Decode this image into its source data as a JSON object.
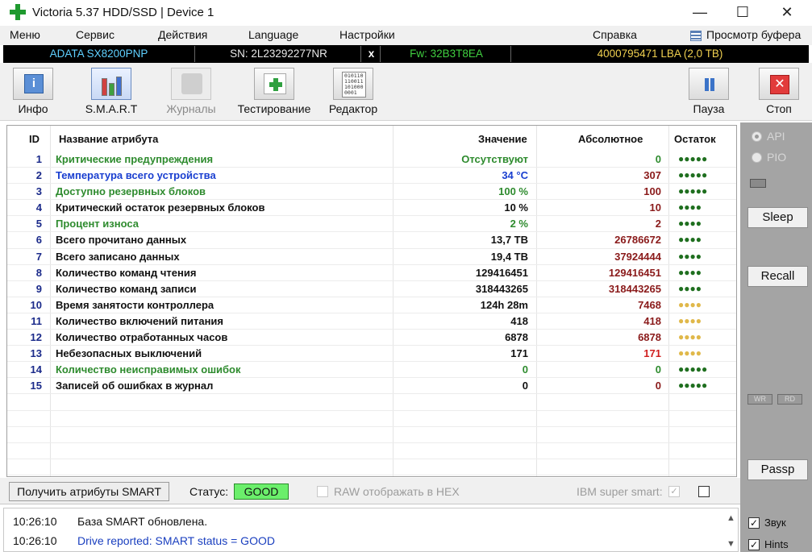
{
  "window": {
    "title": "Victoria 5.37 HDD/SSD | Device 1",
    "min_glyph": "—",
    "max_glyph": "☐",
    "close_glyph": "✕"
  },
  "menu": {
    "items": [
      "Меню",
      "Сервис",
      "Действия",
      "Language",
      "Настройки",
      "Справка"
    ],
    "buffer_view": "Просмотр буфера"
  },
  "device": {
    "model": "ADATA SX8200PNP",
    "serial": "SN: 2L23292277NR",
    "close_mark": "x",
    "firmware": "Fw: 32B3T8EA",
    "lba": "4000795471 LBA (2,0 TB)"
  },
  "toolbar": {
    "info": "Инфо",
    "smart": "S.M.A.R.T",
    "journals": "Журналы",
    "testing": "Тестирование",
    "editor": "Редактор",
    "pause": "Пауза",
    "stop": "Стоп",
    "info_glyph": "i",
    "stop_glyph": "✕",
    "editor_glyph": "010110 110011 101000 0001"
  },
  "table": {
    "headers": {
      "id": "ID",
      "name": "Название атрибута",
      "value": "Значение",
      "absolute": "Абсолютное",
      "remaining": "Остаток"
    },
    "rows": [
      {
        "id": "1",
        "name": "Критические предупреждения",
        "value": "Отсутствуют",
        "absolute": "0",
        "remaining": "●●●●●",
        "name_color": "#2e8b2e",
        "value_color": "#2e8b2e",
        "abs_color": "#2e8b2e",
        "rem_color": "#1f6f1f"
      },
      {
        "id": "2",
        "name": "Температура всего устройства",
        "value": "34 °C",
        "absolute": "307",
        "remaining": "●●●●●",
        "name_color": "#1a3fd0",
        "value_color": "#1a3fd0",
        "abs_color": "#8a1a1a",
        "rem_color": "#1f6f1f"
      },
      {
        "id": "3",
        "name": "Доступно резервных блоков",
        "value": "100 %",
        "absolute": "100",
        "remaining": "●●●●●",
        "name_color": "#2e8b2e",
        "value_color": "#2e8b2e",
        "abs_color": "#8a1a1a",
        "rem_color": "#1f6f1f"
      },
      {
        "id": "4",
        "name": "Критический остаток резервных блоков",
        "value": "10 %",
        "absolute": "10",
        "remaining": "●●●●",
        "name_color": "#111111",
        "value_color": "#111111",
        "abs_color": "#8a1a1a",
        "rem_color": "#1f6f1f"
      },
      {
        "id": "5",
        "name": "Процент износа",
        "value": "2 %",
        "absolute": "2",
        "remaining": "●●●●",
        "name_color": "#2e8b2e",
        "value_color": "#2e8b2e",
        "abs_color": "#8a1a1a",
        "rem_color": "#1f6f1f"
      },
      {
        "id": "6",
        "name": "Всего прочитано данных",
        "value": "13,7 TB",
        "absolute": "26786672",
        "remaining": "●●●●",
        "name_color": "#111111",
        "value_color": "#111111",
        "abs_color": "#8a1a1a",
        "rem_color": "#1f6f1f"
      },
      {
        "id": "7",
        "name": "Всего записано данных",
        "value": "19,4 TB",
        "absolute": "37924444",
        "remaining": "●●●●",
        "name_color": "#111111",
        "value_color": "#111111",
        "abs_color": "#8a1a1a",
        "rem_color": "#1f6f1f"
      },
      {
        "id": "8",
        "name": "Количество команд чтения",
        "value": "129416451",
        "absolute": "129416451",
        "remaining": "●●●●",
        "name_color": "#111111",
        "value_color": "#111111",
        "abs_color": "#8a1a1a",
        "rem_color": "#1f6f1f"
      },
      {
        "id": "9",
        "name": "Количество команд записи",
        "value": "318443265",
        "absolute": "318443265",
        "remaining": "●●●●",
        "name_color": "#111111",
        "value_color": "#111111",
        "abs_color": "#8a1a1a",
        "rem_color": "#1f6f1f"
      },
      {
        "id": "10",
        "name": "Время занятости контроллера",
        "value": "124h 28m",
        "absolute": "7468",
        "remaining": "●●●●",
        "name_color": "#111111",
        "value_color": "#111111",
        "abs_color": "#8a1a1a",
        "rem_color": "#e0b84a"
      },
      {
        "id": "11",
        "name": "Количество включений питания",
        "value": "418",
        "absolute": "418",
        "remaining": "●●●●",
        "name_color": "#111111",
        "value_color": "#111111",
        "abs_color": "#8a1a1a",
        "rem_color": "#e0b84a"
      },
      {
        "id": "12",
        "name": "Количество отработанных часов",
        "value": "6878",
        "absolute": "6878",
        "remaining": "●●●●",
        "name_color": "#111111",
        "value_color": "#111111",
        "abs_color": "#8a1a1a",
        "rem_color": "#e0b84a"
      },
      {
        "id": "13",
        "name": "Небезопасных выключений",
        "value": "171",
        "absolute": "171",
        "remaining": "●●●●",
        "name_color": "#111111",
        "value_color": "#111111",
        "abs_color": "#d02020",
        "rem_color": "#e0b84a"
      },
      {
        "id": "14",
        "name": "Количество неисправимых ошибок",
        "value": "0",
        "absolute": "0",
        "remaining": "●●●●●",
        "name_color": "#2e8b2e",
        "value_color": "#2e8b2e",
        "abs_color": "#2e8b2e",
        "rem_color": "#1f6f1f"
      },
      {
        "id": "15",
        "name": "Записей об ошибках в журнал",
        "value": "0",
        "absolute": "0",
        "remaining": "●●●●●",
        "name_color": "#111111",
        "value_color": "#111111",
        "abs_color": "#8a1a1a",
        "rem_color": "#1f6f1f"
      }
    ]
  },
  "side": {
    "api": "API",
    "pio": "PIO",
    "sleep": "Sleep",
    "recall": "Recall",
    "wr": "WR",
    "rd": "RD",
    "passp": "Passp"
  },
  "status": {
    "get_smart": "Получить атрибуты SMART",
    "label": "Статус:",
    "value": "GOOD",
    "raw_hex": "RAW отображать в HEX",
    "ibm": "IBM super smart:",
    "ibm_check": "✓"
  },
  "log": {
    "lines": [
      {
        "time": "10:26:10",
        "message": "База SMART обновлена."
      },
      {
        "time": "10:26:10",
        "message": "Drive reported: SMART status = GOOD"
      }
    ],
    "up_arrow": "▲",
    "down_arrow": "▼"
  },
  "options": {
    "sound": "Звук",
    "hints": "Hints",
    "check": "✓"
  }
}
